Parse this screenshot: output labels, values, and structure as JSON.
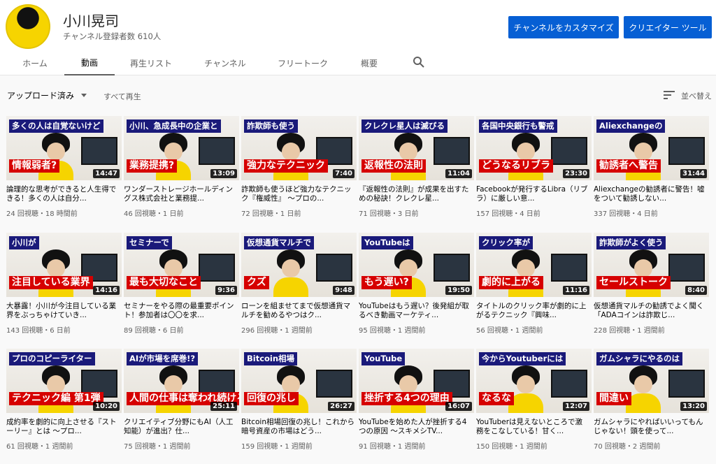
{
  "channel": {
    "name": "小川晃司",
    "subscribers": "チャンネル登録者数 610人"
  },
  "buttons": {
    "customize": "チャンネルをカスタマイズ",
    "creator_tools": "クリエイター ツール"
  },
  "tabs": [
    "ホーム",
    "動画",
    "再生リスト",
    "チャンネル",
    "フリートーク",
    "概要"
  ],
  "active_tab": "動画",
  "toolbar": {
    "filter": "アップロード済み",
    "play_all": "すべて再生",
    "sort": "並べ替え"
  },
  "videos": [
    {
      "top": "多くの人は自覚ないけど",
      "bottom": "情報弱者?",
      "duration": "14:47",
      "title": "論理的な思考ができると人生得できる！多くの人は自分...",
      "meta": "24 回視聴・18 時間前"
    },
    {
      "top": "小川、急成長中の企業と",
      "bottom": "業務提携?",
      "duration": "13:09",
      "title": "ワンダーストレージホールディングス株式会社と業務提...",
      "meta": "46 回視聴・1 日前"
    },
    {
      "top": "詐欺師も使う",
      "bottom": "強力なテクニック",
      "duration": "7:40",
      "title": "詐欺師も使うほど強力なテクニック『権威性』 〜プロの...",
      "meta": "72 回視聴・1 日前"
    },
    {
      "top": "クレクレ星人は滅びる",
      "bottom": "返報性の法則",
      "duration": "11:04",
      "title": "『返報性の法則』が成果を出すための秘訣！クレクレ星...",
      "meta": "71 回視聴・3 日前"
    },
    {
      "top": "各国中央銀行も警戒",
      "bottom": "どうなるリブラ",
      "duration": "23:30",
      "title": "Facebookが発行するLibra（リブラ）に厳しい意...",
      "meta": "157 回視聴・4 日前"
    },
    {
      "top": "Aliexchangeの",
      "bottom": "勧誘者へ警告",
      "duration": "31:44",
      "title": "Aliexchangeの勧誘者に警告！嘘をついて勧誘しない...",
      "meta": "337 回視聴・4 日前"
    },
    {
      "top": "小川が",
      "bottom": "注目している業界",
      "duration": "14:16",
      "title": "大暴露！小川が今注目している業界をぶっちゃけていき...",
      "meta": "143 回視聴・6 日前"
    },
    {
      "top": "セミナーで",
      "bottom": "最も大切なこと",
      "duration": "9:36",
      "title": "セミナーをやる際の最重要ポイント！参加者は〇〇を求...",
      "meta": "89 回視聴・6 日前"
    },
    {
      "top": "仮想通貨マルチで",
      "bottom": "クズ",
      "duration": "9:48",
      "title": "ローンを組ませてまで仮想通貨マルチを勧めるやつはク...",
      "meta": "296 回視聴・1 週間前"
    },
    {
      "top": "YouTubeは",
      "bottom": "もう遅い?",
      "duration": "19:50",
      "title": "YouTubeはもう遅い？後発組が取るべき動画マーケティ...",
      "meta": "95 回視聴・1 週間前"
    },
    {
      "top": "クリック率が",
      "bottom": "劇的に上がる",
      "duration": "11:16",
      "title": "タイトルのクリック率が劇的に上がるテクニック『興味...",
      "meta": "56 回視聴・1 週間前"
    },
    {
      "top": "詐欺師がよく使う",
      "bottom": "セールストーク",
      "duration": "8:40",
      "title": "仮想通貨マルチの勧誘でよく聞く「ADAコインは詐欺じ...",
      "meta": "228 回視聴・1 週間前"
    },
    {
      "top": "プロのコピーライター",
      "bottom": "テクニック編 第1弾",
      "duration": "10:20",
      "title": "成約率を劇的に向上させる『ストーリー』とは 〜プロ...",
      "meta": "61 回視聴・1 週間前"
    },
    {
      "top": "AIが市場を席巻!?",
      "bottom": "人間の仕事は奪われ続けるのか!?",
      "duration": "25:11",
      "title": "クリエイティブ分野にもAI（人工知能）が進出？仕...",
      "meta": "75 回視聴・1 週間前"
    },
    {
      "top": "Bitcoin相場",
      "bottom": "回復の兆し",
      "duration": "26:27",
      "title": "Bitcoin相場回復の兆し！これから暗号資産の市場はどう...",
      "meta": "159 回視聴・1 週間前"
    },
    {
      "top": "YouTube",
      "bottom": "挫折する4つの理由",
      "duration": "16:07",
      "title": "YouTubeを始めた人が挫折する4つの原因 〜スキメシTV...",
      "meta": "91 回視聴・1 週間前"
    },
    {
      "top": "今からYoutuberには",
      "bottom": "なるな",
      "duration": "12:07",
      "title": "YouTuberは見えないところで激務をこなしている！甘く...",
      "meta": "150 回視聴・1 週間前"
    },
    {
      "top": "ガムシャラにやるのは",
      "bottom": "間違い",
      "duration": "13:20",
      "title": "ガムシャラにやればいいってもんじゃない！頭を使って...",
      "meta": "70 回視聴・2 週間前"
    }
  ]
}
